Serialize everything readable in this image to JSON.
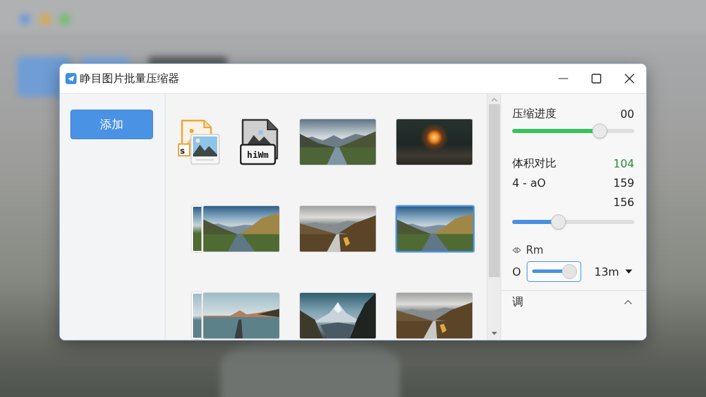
{
  "window": {
    "title": "睁目图片批量压缩器"
  },
  "sidebar": {
    "add_button": "添加"
  },
  "thumbnails": [
    {
      "kind": "color-file",
      "label": "s",
      "selected": false
    },
    {
      "kind": "dark-file",
      "label": "hiWm",
      "selected": false
    },
    {
      "kind": "photo",
      "selected": false
    },
    {
      "kind": "photo",
      "selected": false
    },
    {
      "kind": "photo-stack",
      "selected": false
    },
    {
      "kind": "photo",
      "selected": false
    },
    {
      "kind": "photo",
      "selected": true
    },
    {
      "kind": "photo-stack",
      "selected": false
    },
    {
      "kind": "photo",
      "selected": false
    },
    {
      "kind": "photo",
      "selected": false
    }
  ],
  "panel": {
    "progress": {
      "label": "压缩进度",
      "value": "00",
      "level": 0.72
    },
    "size_compare": {
      "label": "体积对比",
      "value": "104",
      "rows": [
        {
          "label": "4 - aO",
          "value": "159"
        },
        {
          "value": "156"
        }
      ],
      "level": 0.38
    },
    "option": {
      "label": "Rm"
    },
    "field_row": {
      "label": "O",
      "level": 0.85,
      "value": "13m"
    },
    "section": {
      "label": "调",
      "expanded": true
    }
  }
}
